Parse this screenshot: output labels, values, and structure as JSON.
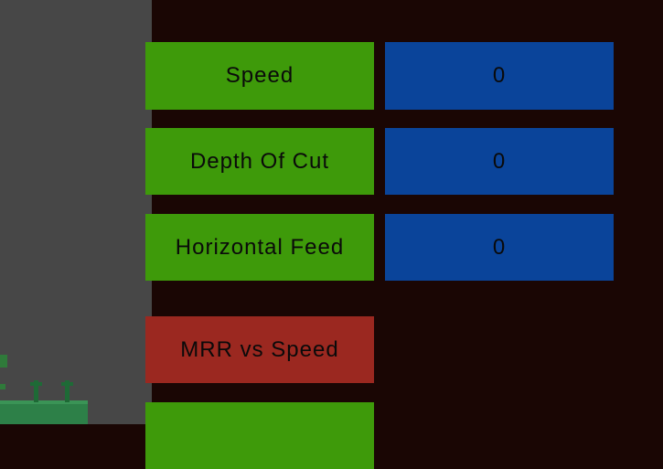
{
  "parameters": [
    {
      "label": "Speed",
      "value": "0"
    },
    {
      "label": "Depth Of Cut",
      "value": "0"
    },
    {
      "label": "Horizontal Feed",
      "value": "0"
    }
  ],
  "graph_buttons": [
    {
      "label": "MRR vs Speed"
    },
    {
      "label": ""
    }
  ],
  "colors": {
    "background": "#1a0604",
    "viewport": "#474747",
    "parameter_button": "#3e9a0a",
    "value_box": "#0a449a",
    "graph_button": "#9b2820"
  }
}
